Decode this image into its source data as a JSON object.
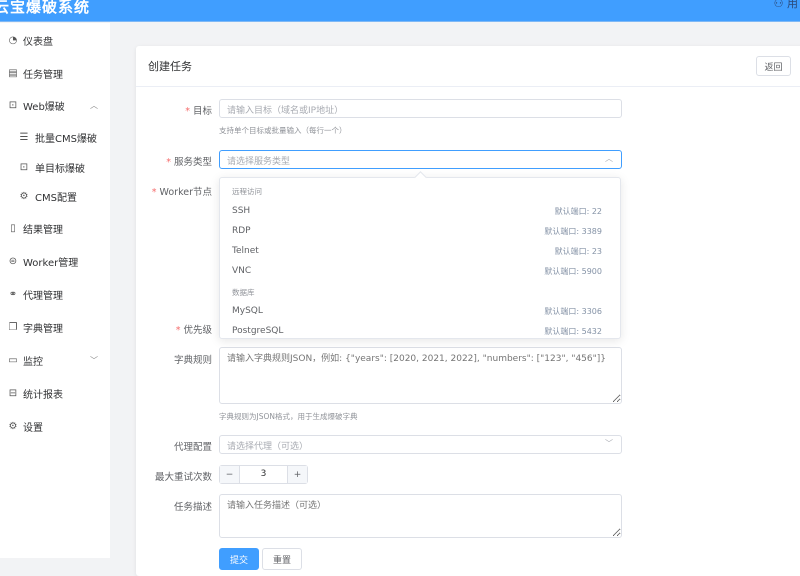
{
  "app": {
    "title": "云宝爆破系统",
    "user": "用"
  },
  "sidebar": {
    "items": [
      {
        "label": "仪表盘",
        "icon": "dashboard-icon"
      },
      {
        "label": "任务管理",
        "icon": "clipboard-icon"
      },
      {
        "label": "Web爆破",
        "icon": "lock-icon"
      },
      {
        "label": "批量CMS爆破",
        "icon": "sliders-icon"
      },
      {
        "label": "单目标爆破",
        "icon": "unlock-icon"
      },
      {
        "label": "CMS配置",
        "icon": "gear-icon"
      },
      {
        "label": "结果管理",
        "icon": "document-icon"
      },
      {
        "label": "Worker管理",
        "icon": "worker-icon"
      },
      {
        "label": "代理管理",
        "icon": "link-icon"
      },
      {
        "label": "字典管理",
        "icon": "copy-icon"
      },
      {
        "label": "监控",
        "icon": "monitor-icon"
      },
      {
        "label": "统计报表",
        "icon": "chart-icon"
      },
      {
        "label": "设置",
        "icon": "settings-icon"
      }
    ]
  },
  "card": {
    "title": "创建任务",
    "back": "返回"
  },
  "form": {
    "target": {
      "label": "目标",
      "placeholder": "请输入目标（域名或IP地址）",
      "help": "支持单个目标或批量输入（每行一个）"
    },
    "service": {
      "label": "服务类型",
      "placeholder": "请选择服务类型"
    },
    "worker": {
      "label": "Worker节点"
    },
    "priority": {
      "label": "优先级"
    },
    "dict": {
      "label": "字典规则",
      "placeholder": "请输入字典规则JSON，例如: {\"years\": [2020, 2021, 2022], \"numbers\": [\"123\", \"456\"]}",
      "help": "字典规则为JSON格式，用于生成爆破字典"
    },
    "proxy": {
      "label": "代理配置",
      "placeholder": "请选择代理（可选）"
    },
    "retry": {
      "label": "最大重试次数",
      "value": "3",
      "minus": "−",
      "plus": "+"
    },
    "desc": {
      "label": "任务描述",
      "placeholder": "请输入任务描述（可选）"
    },
    "submit": "提交",
    "reset": "重置"
  },
  "dropdown": {
    "group1": "远程访问",
    "group2": "数据库",
    "options": [
      {
        "name": "SSH",
        "port": "默认端口: 22"
      },
      {
        "name": "RDP",
        "port": "默认端口: 3389"
      },
      {
        "name": "Telnet",
        "port": "默认端口: 23"
      },
      {
        "name": "VNC",
        "port": "默认端口: 5900"
      },
      {
        "name": "MySQL",
        "port": "默认端口: 3306"
      },
      {
        "name": "PostgreSQL",
        "port": "默认端口: 5432"
      }
    ]
  }
}
